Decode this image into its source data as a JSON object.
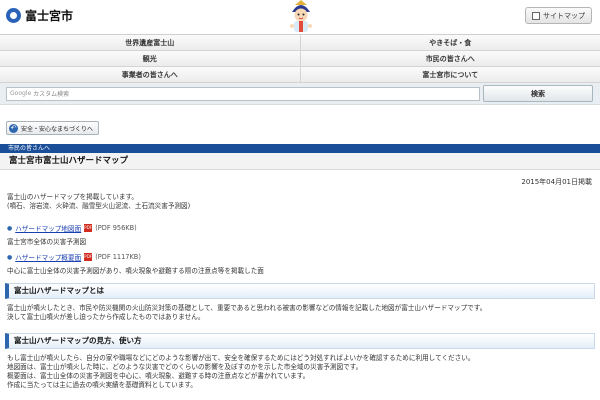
{
  "header": {
    "logo_text": "富士宮市",
    "sitemap_label": "サイトマップ"
  },
  "nav": {
    "rows": [
      [
        "世界遺産富士山",
        "やきそば・食"
      ],
      [
        "観光",
        "市民の皆さんへ"
      ],
      [
        "事業者の皆さんへ",
        "富士宮市について"
      ]
    ]
  },
  "search": {
    "google_label": "Google",
    "placeholder": "カスタム検索",
    "button_label": "検索"
  },
  "back_button": {
    "label": "安全・安心なまちづくりへ"
  },
  "breadcrumb": "市民の皆さんへ",
  "page_title": "富士宮市富士山ハザードマップ",
  "date": "2015年04月01日掲載",
  "intro": {
    "line1": "富士山のハザードマップを掲載しています。",
    "line2": "(噴石、溶岩流、火砕流、融雪型火山泥流、土石流災害予測図)"
  },
  "pdf_links": [
    {
      "label": "ハザードマップ地図面",
      "size": "(PDF 956KB)",
      "desc": "富士宮市全体の災害予測図"
    },
    {
      "label": "ハザードマップ概要面",
      "size": "(PDF 1117KB)",
      "desc": "中心に富士山全体の災害予測図があり、噴火現象や避難する際の注意点等を掲載した面"
    }
  ],
  "sections": [
    {
      "title": "富士山ハザードマップとは",
      "lines": [
        "富士山が噴火したとき、市民や防災機関の火山防災対策の基礎として、重要であると思われる被害の影響などの情報を記載した地図が富士山ハザードマップです。",
        "決して富士山噴火が差し迫ったから作成したものではありません。"
      ]
    },
    {
      "title": "富士山ハザードマップの見方、使い方",
      "lines": [
        "もし富士山が噴火したら、自分の家や職場などにどのような影響が出て、安全を確保するためにはどう対処すればよいかを確認するために利用してください。",
        "地図面は、富士山が噴火した時に、どのような災害でどのくらいの影響を及ぼすのかを示した市全域の災害予測図です。",
        "概要面は、富士山全体の災害予測図を中心に、噴火現象、避難する時の注意点などが書かれています。",
        "作成に当たっては主に過去の噴火実績を基礎資料としています。"
      ]
    }
  ]
}
